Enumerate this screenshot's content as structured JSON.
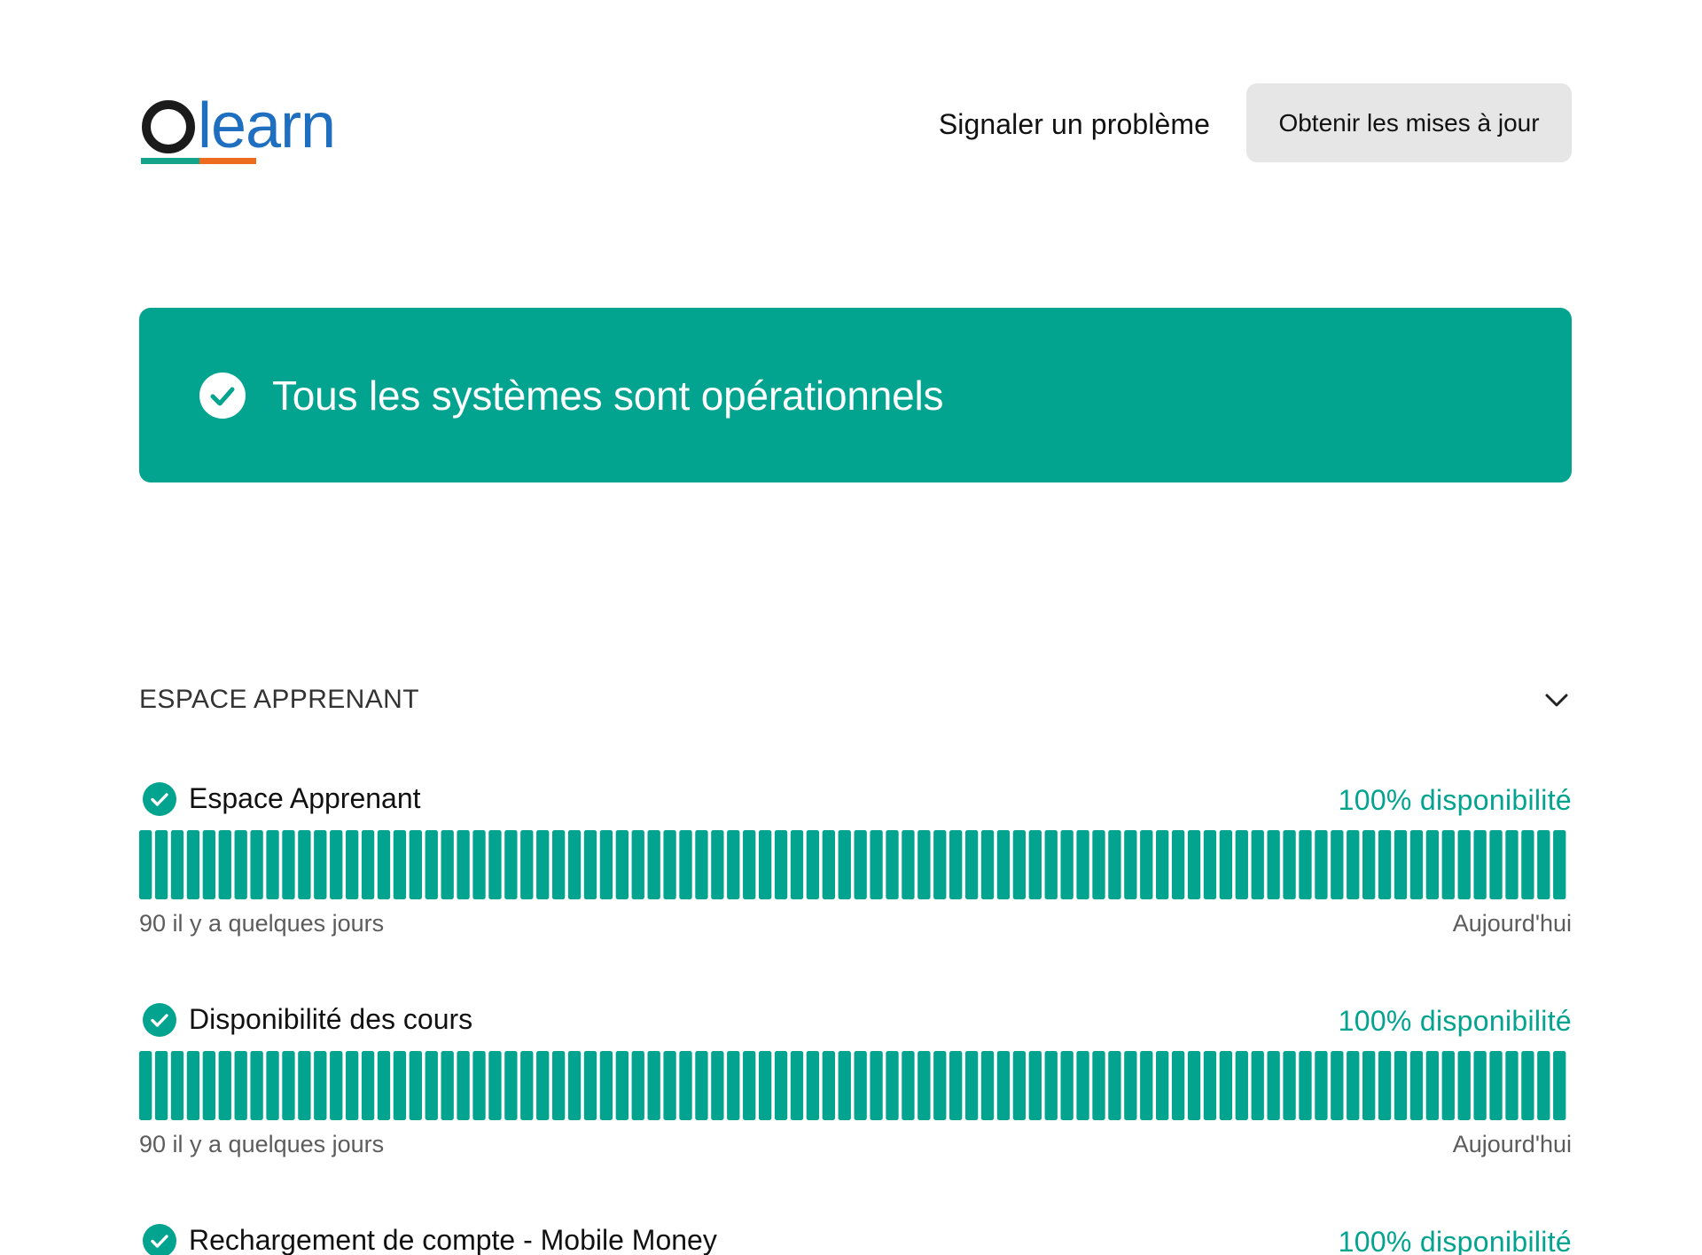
{
  "header": {
    "logo_text": "Olearn",
    "report_link": "Signaler un problème",
    "updates_button": "Obtenir les mises à jour"
  },
  "banner": {
    "status_text": "Tous les systèmes sont opérationnels",
    "icon": "check-circle-icon",
    "color": "#02a38f"
  },
  "section": {
    "title": "ESPACE APPRENANT",
    "toggle_icon": "chevron-down-icon"
  },
  "components": [
    {
      "name": "Espace Apprenant",
      "uptime": "100% disponibilité",
      "range_start": "90 il y a quelques jours",
      "range_end": "Aujourd'hui",
      "status": "operational",
      "days": 90
    },
    {
      "name": "Disponibilité des cours",
      "uptime": "100% disponibilité",
      "range_start": "90 il y a quelques jours",
      "range_end": "Aujourd'hui",
      "status": "operational",
      "days": 90
    },
    {
      "name": "Rechargement de compte - Mobile Money",
      "uptime": "100% disponibilité",
      "status": "operational"
    }
  ],
  "colors": {
    "operational": "#02a38f",
    "button_bg": "#e6e6e6",
    "logo_dark": "#1b1b1b",
    "logo_blue": "#1f6fc0",
    "logo_teal": "#14a38b",
    "logo_orange": "#ee6a1f"
  }
}
